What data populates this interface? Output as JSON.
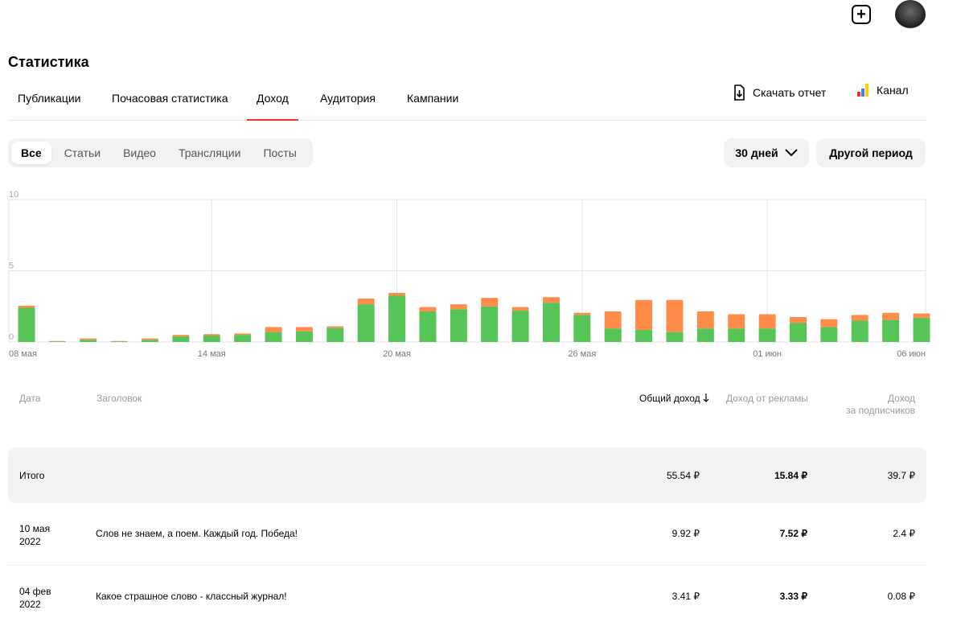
{
  "header": {
    "title": "Статистика",
    "add_icon": "plus-square-icon",
    "avatar_icon": "user-avatar"
  },
  "tabs": [
    {
      "label": "Публикации",
      "active": false
    },
    {
      "label": "Почасовая статистика",
      "active": false
    },
    {
      "label": "Доход",
      "active": true
    },
    {
      "label": "Аудитория",
      "active": false
    },
    {
      "label": "Кампании",
      "active": false
    }
  ],
  "actions": {
    "download_label": "Скачать отчет",
    "download_icon": "download-file-icon",
    "channel_label": "Канал",
    "channel_icon": "bar-chart-icon"
  },
  "filters": [
    {
      "label": "Все",
      "active": true
    },
    {
      "label": "Статьи",
      "active": false
    },
    {
      "label": "Видео",
      "active": false
    },
    {
      "label": "Трансляции",
      "active": false
    },
    {
      "label": "Посты",
      "active": false
    }
  ],
  "period": {
    "selected": "30 дней",
    "other_label": "Другой период"
  },
  "chart_data": {
    "type": "bar",
    "stacked": true,
    "ylim": [
      0,
      10
    ],
    "yticks": [
      "10",
      "5",
      "0"
    ],
    "grid": true,
    "xtick_labels": [
      "08 мая",
      "14 мая",
      "20 мая",
      "26 мая",
      "01 июн",
      "06 июн"
    ],
    "colors": {
      "green": "#56c456",
      "orange": "#ff8c48"
    },
    "series": [
      {
        "values": [
          2.4,
          0.05,
          0.15,
          0.05,
          0.15,
          0.4,
          0.45,
          0.5,
          0.7,
          0.75,
          1.0,
          2.65,
          3.25,
          2.15,
          2.3,
          2.5,
          2.2,
          2.75,
          1.9,
          0.95,
          0.85,
          0.7,
          0.95,
          0.95,
          0.95,
          1.35,
          1.05,
          1.5,
          1.55,
          1.7
        ]
      },
      {
        "values": [
          0.15,
          0.02,
          0.1,
          0.02,
          0.1,
          0.1,
          0.1,
          0.1,
          0.35,
          0.3,
          0.1,
          0.4,
          0.2,
          0.3,
          0.35,
          0.6,
          0.25,
          0.4,
          0.15,
          1.2,
          2.1,
          2.25,
          1.2,
          1.0,
          1.0,
          0.4,
          0.55,
          0.4,
          0.5,
          0.3
        ]
      }
    ]
  },
  "table": {
    "headers": {
      "date": "Дата",
      "title": "Заголовок",
      "total": "Общий доход",
      "ads": "Доход от рекламы",
      "subs_line1": "Доход",
      "subs_line2": "за подписчиков"
    },
    "sort_icon": "arrow-down-icon",
    "total_row": {
      "label": "Итого",
      "total": "55.54 ₽",
      "ads": "15.84 ₽",
      "subs": "39.7 ₽"
    },
    "rows": [
      {
        "date_line1": "10 мая",
        "date_line2": "2022",
        "title": "Слов не знаем, а поем. Каждый год. Победа!",
        "total": "9.92 ₽",
        "ads": "7.52 ₽",
        "subs": "2.4 ₽"
      },
      {
        "date_line1": "04 фев",
        "date_line2": "2022",
        "title": "Какое страшное слово - классный журнал!",
        "total": "3.41 ₽",
        "ads": "3.33 ₽",
        "subs": "0.08 ₽"
      }
    ]
  }
}
